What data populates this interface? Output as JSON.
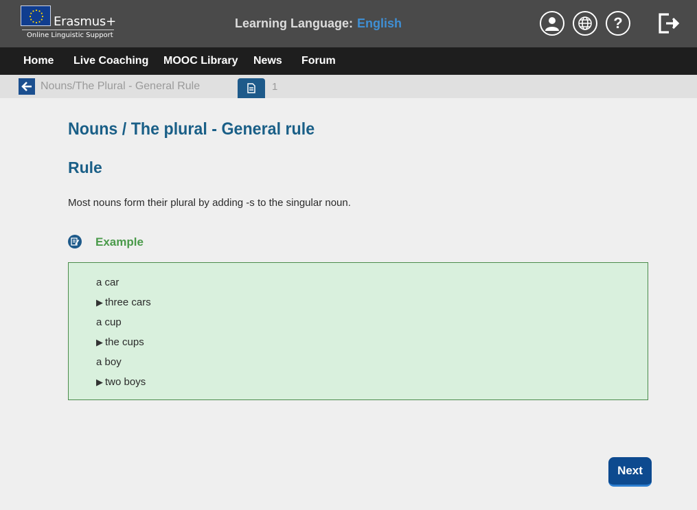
{
  "brand": {
    "name": "Erasmus+",
    "subtitle": "Online Linguistic Support"
  },
  "header": {
    "language_label": "Learning Language:",
    "language_value": "English",
    "help_glyph": "?"
  },
  "nav": {
    "items": [
      "Home",
      "Live Coaching",
      "MOOC Library",
      "News",
      "Forum"
    ]
  },
  "breadcrumb": {
    "title": "Nouns/The Plural - General Rule",
    "page_number": "1"
  },
  "content": {
    "title": "Nouns / The plural - General rule",
    "rule_heading": "Rule",
    "rule_text": "Most nouns form their plural by adding -s to the singular noun.",
    "example_label": "Example",
    "examples": [
      {
        "text": "a car",
        "arrow": false
      },
      {
        "text": "three cars",
        "arrow": true
      },
      {
        "text": "a cup",
        "arrow": false
      },
      {
        "text": "the cups",
        "arrow": true
      },
      {
        "text": "a boy",
        "arrow": false
      },
      {
        "text": "two boys",
        "arrow": true
      }
    ]
  },
  "footer": {
    "next_label": "Next"
  },
  "icons": {
    "user": "user-icon",
    "globe": "globe-icon",
    "help": "help-icon",
    "logout": "logout-icon",
    "back": "back-arrow-icon",
    "document": "document-icon",
    "example": "edit-note-icon",
    "arrow": "play-triangle-icon"
  },
  "colors": {
    "header_bg": "#4a4a4a",
    "nav_bg": "#1e1e1e",
    "accent": "#1a5f87",
    "language": "#3f8fd4",
    "example_green": "#4a9a4a",
    "example_bg": "#d9f0dd",
    "next_bg": "#0d4a8f"
  }
}
